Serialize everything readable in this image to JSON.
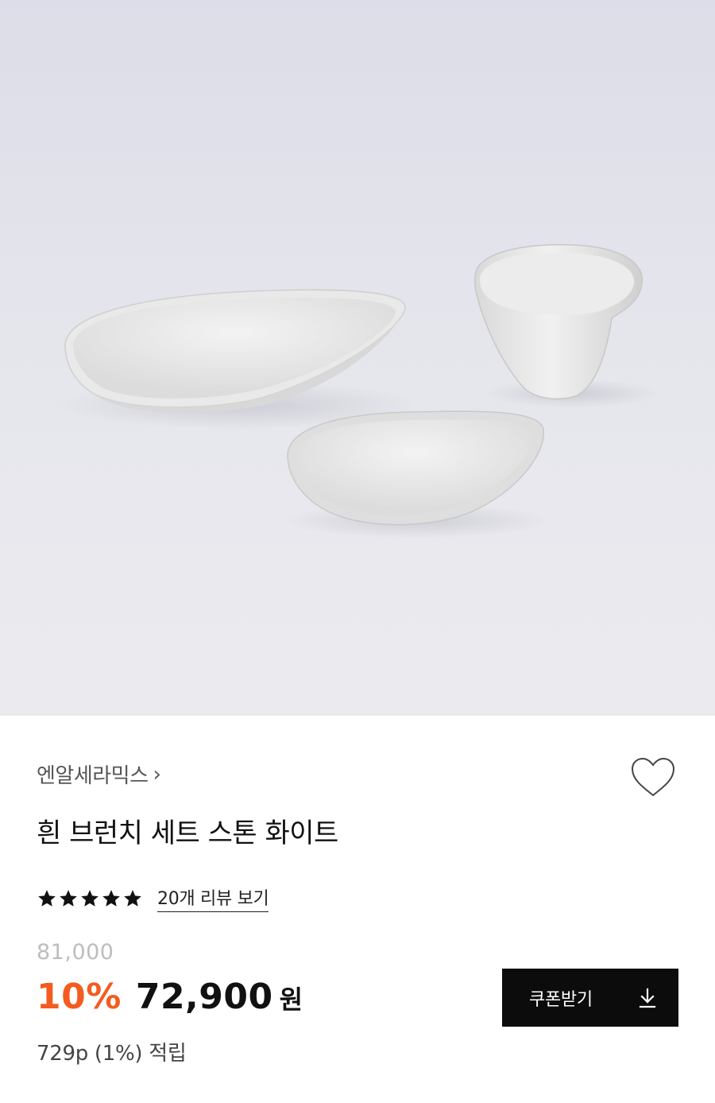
{
  "product_image": {
    "alt_icon": "product-photo-tableware"
  },
  "brand": {
    "name": "엔알세라믹스",
    "chevron": "›"
  },
  "wishlist": {
    "icon": "heart-outline-icon"
  },
  "product": {
    "title": "흰 브런치 세트 스톤 화이트"
  },
  "rating": {
    "stars": 5,
    "max_stars": 5,
    "review_link": "20개 리뷰 보기"
  },
  "pricing": {
    "original_price": "81,000",
    "discount": "10%",
    "sale_price": "72,900",
    "currency": "원",
    "points": "729p (1%) 적립",
    "accent_color": "#f45b1e"
  },
  "coupon": {
    "label": "쿠폰받기",
    "icon": "download-icon"
  }
}
